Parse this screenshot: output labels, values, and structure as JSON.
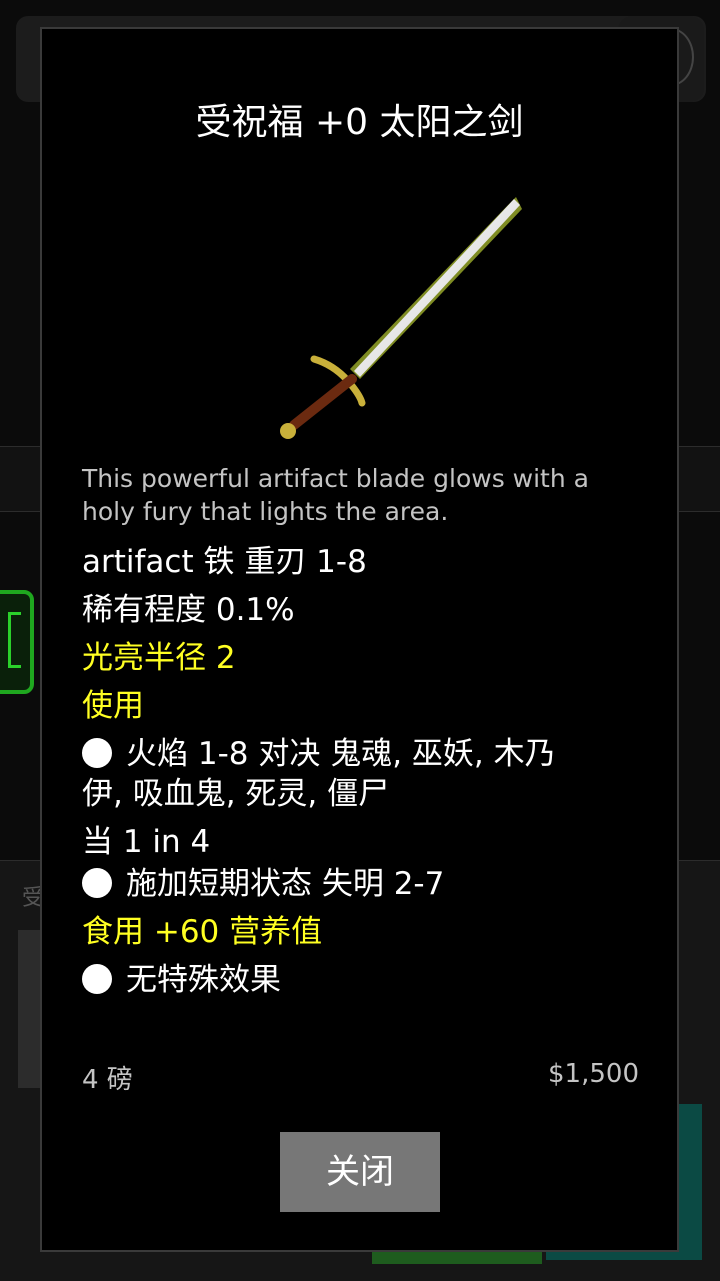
{
  "dialog": {
    "title": "受祝福 +0 太阳之剑",
    "item_icon": "sword-icon",
    "description": "This powerful artifact blade glows with a holy fury that lights the area.",
    "stats": {
      "type_line": "artifact 铁 重刃 1-8",
      "rarity_line": "稀有程度 0.1%",
      "light_line": "光亮半径 2",
      "use_label": "使用",
      "effect1_line1": "火焰 1-8 对决 鬼魂, 巫妖, 木乃",
      "effect1_line2": "伊, 吸血鬼, 死灵, 僵尸",
      "chance_line": "当 1 in 4",
      "effect2": "施加短期状态 失明 2-7",
      "eat_line": "食用 +60 营养值",
      "effect3": "无特殊效果"
    },
    "weight": "4 磅",
    "price": "$1,500",
    "close_label": "关闭"
  },
  "background": {
    "bottom_text": "受"
  },
  "colors": {
    "highlight": "#ffff22",
    "dialog_bg": "#000000",
    "button_bg": "#777777"
  }
}
